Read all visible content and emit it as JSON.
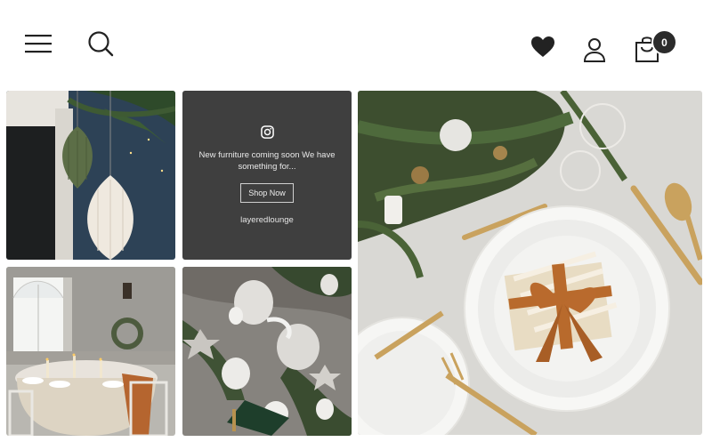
{
  "header": {
    "menu_icon": "hamburger-menu-icon",
    "search_icon": "search-icon",
    "wishlist_icon": "heart-icon",
    "account_icon": "user-icon",
    "cart_icon": "shopping-bag-icon",
    "cart_count": "0"
  },
  "instagram_post": {
    "caption": "New furniture coming soon We have something for...",
    "button_label": "Shop Now",
    "handle": "layeredlounge"
  }
}
